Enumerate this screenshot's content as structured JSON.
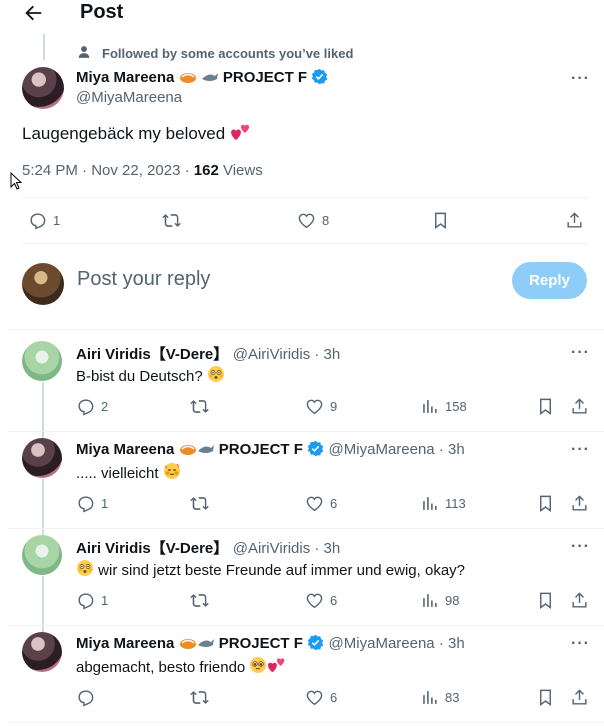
{
  "header": {
    "title": "Post"
  },
  "context": {
    "text": "Followed by some accounts you’ve liked"
  },
  "main_post": {
    "name": "Miya Mareena",
    "name_suffix": "PROJECT F",
    "handle": "@MiyaMareena",
    "text": "Laugengebäck my beloved",
    "time": "5:24 PM · Nov 22, 2023 · ",
    "views_count": "162",
    "views_label": " Views",
    "replies": "1",
    "likes": "8"
  },
  "composer": {
    "placeholder": "Post your reply",
    "button": "Reply"
  },
  "replies": [
    {
      "name": "Airi Viridis【V-Dere】",
      "handle": "@AiriViridis · 3h",
      "text": "B-bist du Deutsch?",
      "replies": "2",
      "likes": "9",
      "views": "158",
      "avatar": "airi"
    },
    {
      "name": "Miya Mareena",
      "name_suffix": "PROJECT F",
      "handle": "@MiyaMareena · 3h",
      "text": "..... vielleicht",
      "replies": "1",
      "likes": "6",
      "views": "113",
      "avatar": "miya"
    },
    {
      "name": "Airi Viridis【V-Dere】",
      "handle": "@AiriViridis · 3h",
      "text": "wir sind jetzt beste Freunde auf immer und ewig, okay?",
      "replies": "1",
      "likes": "6",
      "views": "98",
      "avatar": "airi"
    },
    {
      "name": "Miya Mareena",
      "name_suffix": "PROJECT F",
      "handle": "@MiyaMareena · 3h",
      "text": "abgemacht, besto friendo",
      "replies": "",
      "likes": "6",
      "views": "83",
      "avatar": "miya"
    }
  ],
  "colors": {
    "accent": "#1d9bf0",
    "reply_disabled": "#8ecdf7",
    "secondary_text": "#536471"
  }
}
